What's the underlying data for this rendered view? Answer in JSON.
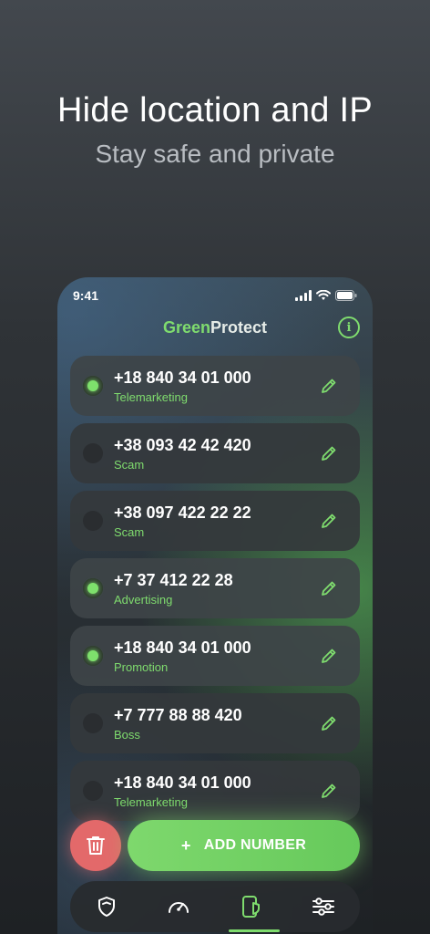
{
  "headline": "Hide location and IP",
  "subline": "Stay safe and private",
  "status": {
    "time": "9:41"
  },
  "app": {
    "logo_green": "Green",
    "logo_plain": "Protect",
    "info_icon": "i"
  },
  "numbers": [
    {
      "number": "+18 840 34 01 000",
      "label": "Telemarketing",
      "enabled": true
    },
    {
      "number": "+38 093 42 42 420",
      "label": "Scam",
      "enabled": false
    },
    {
      "number": "+38 097 422 22 22",
      "label": "Scam",
      "enabled": false
    },
    {
      "number": "+7 37 412 22 28",
      "label": "Advertising",
      "enabled": true
    },
    {
      "number": "+18 840 34 01 000",
      "label": "Promotion",
      "enabled": true
    },
    {
      "number": "+7 777 88 88 420",
      "label": "Boss",
      "enabled": false
    },
    {
      "number": "+18 840 34 01 000",
      "label": "Telemarketing",
      "enabled": false
    }
  ],
  "actions": {
    "add_plus": "+",
    "add_label": "ADD NUMBER"
  },
  "nav": [
    "shield-icon",
    "speedometer-icon",
    "phone-shield-icon",
    "sliders-icon"
  ],
  "colors": {
    "accent": "#7fdc6e",
    "danger": "#e3696a"
  }
}
